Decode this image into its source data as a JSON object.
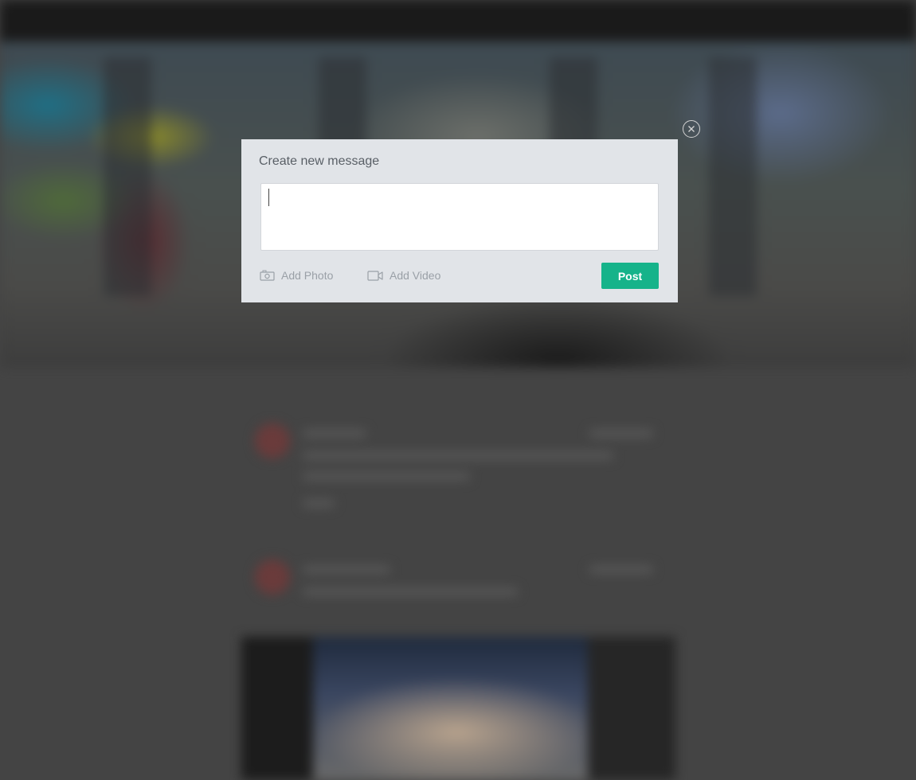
{
  "modal": {
    "title": "Create new message",
    "message_value": "",
    "add_photo_label": "Add Photo",
    "add_video_label": "Add Video",
    "post_label": "Post"
  },
  "icons": {
    "close": "close-icon",
    "photo": "camera-icon",
    "video": "video-camera-icon"
  },
  "colors": {
    "accent": "#16b38a",
    "modal_background": "#e1e4e8",
    "backdrop": "#444444"
  }
}
